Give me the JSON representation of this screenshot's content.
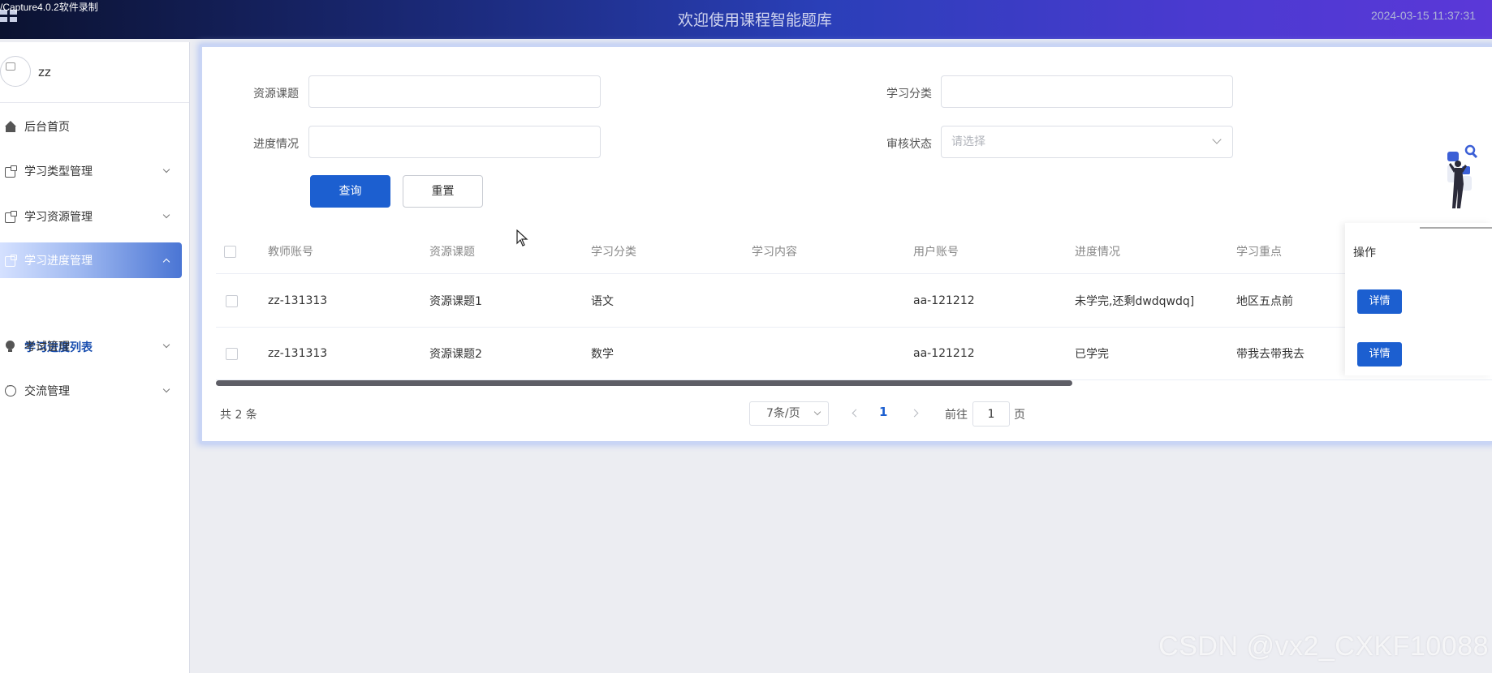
{
  "header": {
    "recorder_watermark": "/Capture4.0.2软件录制",
    "title": "欢迎使用课程智能题库",
    "datetime": "2024-03-15 11:37:31"
  },
  "sidebar": {
    "username": "zz",
    "items": [
      {
        "label": "后台首页",
        "icon": "home-icon"
      },
      {
        "label": "学习类型管理",
        "icon": "document-icon"
      },
      {
        "label": "学习资源管理",
        "icon": "document-icon"
      },
      {
        "label": "学习进度管理",
        "icon": "document-icon",
        "active": true
      },
      {
        "label": "考试管理",
        "icon": "bulb-icon"
      },
      {
        "label": "交流管理",
        "icon": "chat-icon"
      }
    ],
    "submenu": {
      "label": "学习进度列表"
    }
  },
  "search": {
    "resource_label": "资源课题",
    "resource_value": "",
    "category_label": "学习分类",
    "category_value": "",
    "progress_label": "进度情况",
    "progress_value": "",
    "status_label": "审核状态",
    "status_placeholder": "请选择",
    "query_button": "查询",
    "reset_button": "重置"
  },
  "table": {
    "columns": [
      "教师账号",
      "资源课题",
      "学习分类",
      "学习内容",
      "用户账号",
      "进度情况",
      "学习重点",
      "操作"
    ],
    "rows": [
      {
        "teacher": "zz-131313",
        "resource": "资源课题1",
        "category": "语文",
        "content": "",
        "user": "aa-121212",
        "progress": "未学完,还剩dwdqwdq]",
        "focus": "地区五点前",
        "action": "详情"
      },
      {
        "teacher": "zz-131313",
        "resource": "资源课题2",
        "category": "数学",
        "content": "",
        "user": "aa-121212",
        "progress": "已学完",
        "focus": "带我去带我去",
        "action": "详情"
      }
    ]
  },
  "pagination": {
    "total": "共 2 条",
    "page_size": "7条/页",
    "current_page": "1",
    "goto_label": "前往",
    "goto_value": "1",
    "page_suffix": "页"
  },
  "watermark": "CSDN @vx2_CXKF10088",
  "colors": {
    "primary": "#1c5fd0",
    "header_start": "#0b1230",
    "header_end": "#5b38d8"
  }
}
